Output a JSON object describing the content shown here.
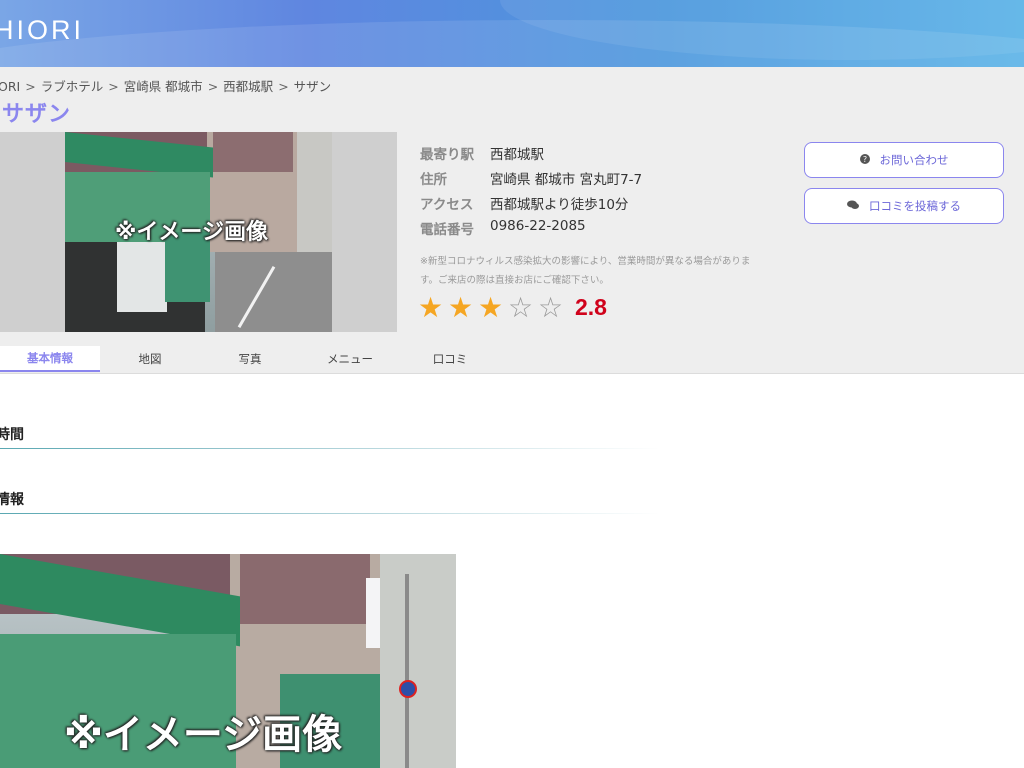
{
  "header": {
    "logo": "HIORI"
  },
  "breadcrumb": {
    "items": [
      "ORI",
      "ラブホテル",
      "宮崎県 都城市",
      "西都城駅",
      "サザン"
    ],
    "separator": ">"
  },
  "page_title": "サザン",
  "hero_image": {
    "caption": "※イメージ画像"
  },
  "info": {
    "rows": [
      {
        "label": "最寄り駅",
        "value": "西都城駅"
      },
      {
        "label": "住所",
        "value": "宮崎県 都城市 宮丸町7-7"
      },
      {
        "label": "アクセス",
        "value": "西都城駅より徒歩10分"
      },
      {
        "label": "電話番号",
        "value": "0986-22-2085"
      }
    ],
    "notice": "※新型コロナウィルス感染拡大の影響により、営業時間が異なる場合があります。ご来店の際は直接お店にご確認下さい。"
  },
  "rating": {
    "value": "2.8",
    "stars_filled": 3,
    "stars_total": 5
  },
  "buttons": {
    "contact": {
      "label": "お問い合わせ",
      "icon": "question-circle-icon"
    },
    "review": {
      "label": "口コミを投稿する",
      "icon": "comments-icon"
    }
  },
  "tabs": [
    {
      "label": "基本情報",
      "active": true
    },
    {
      "label": "地図",
      "active": false
    },
    {
      "label": "写真",
      "active": false
    },
    {
      "label": "メニュー",
      "active": false
    },
    {
      "label": "口コミ",
      "active": false
    }
  ],
  "sections": [
    {
      "heading": "時間"
    },
    {
      "heading": "情報"
    }
  ],
  "main_image": {
    "caption": "※イメージ画像"
  },
  "colors": {
    "accent": "#8b86ee",
    "rating": "#d0021b",
    "star": "#f5a623"
  }
}
